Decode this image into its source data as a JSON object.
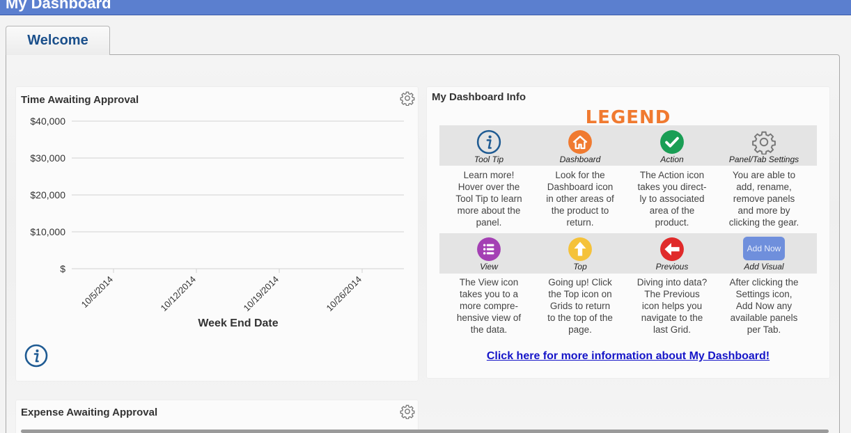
{
  "header": {
    "title": "My Dashboard"
  },
  "tabs": [
    {
      "label": "Welcome",
      "active": true
    }
  ],
  "time_panel": {
    "title": "Time Awaiting Approval",
    "settings_icon": "gear-icon",
    "info_icon": "info-icon"
  },
  "chart_data": {
    "type": "bar",
    "title": "Time Awaiting Approval",
    "xlabel": "Week End Date",
    "ylabel": "",
    "categories": [
      "10/5/2014",
      "10/12/2014",
      "10/19/2014",
      "10/26/2014"
    ],
    "values": [
      0,
      0,
      0,
      0
    ],
    "y_ticks": [
      "$40,000",
      "$30,000",
      "$20,000",
      "$10,000",
      "$"
    ],
    "y_tick_values": [
      40000,
      30000,
      20000,
      10000,
      0
    ],
    "ylim": [
      0,
      40000
    ],
    "grid": true
  },
  "info_panel": {
    "title": "My Dashboard Info",
    "legend_title": "LEGEND",
    "items": [
      {
        "name": "Tool Tip",
        "icon": "info-icon",
        "desc": [
          "Learn more!",
          "Hover over the",
          "Tool Tip to learn",
          "more about the",
          "panel."
        ]
      },
      {
        "name": "Dashboard",
        "icon": "home-icon",
        "desc": [
          "Look for the",
          "Dashboard icon",
          "in other areas of",
          "the product to",
          "return."
        ]
      },
      {
        "name": "Action",
        "icon": "check-icon",
        "desc": [
          "The Action icon",
          "takes you direct-",
          "ly to associated",
          "area of the",
          "product."
        ]
      },
      {
        "name": "Panel/Tab Settings",
        "icon": "gear-icon",
        "desc": [
          "You are able to",
          "add, rename,",
          "remove panels",
          "and more by",
          "clicking the gear."
        ]
      },
      {
        "name": "View",
        "icon": "list-icon",
        "desc": [
          "The View icon",
          "takes you to a",
          "more compre-",
          "hensive view of",
          "the data."
        ]
      },
      {
        "name": "Top",
        "icon": "arrow-up-icon",
        "desc": [
          "Going up! Click",
          "the Top icon on",
          "Grids to return",
          "to the top of the",
          "page."
        ]
      },
      {
        "name": "Previous",
        "icon": "arrow-left-icon",
        "desc": [
          "Diving into data?",
          "The Previous",
          "icon helps you",
          "navigate to the",
          "last Grid."
        ]
      },
      {
        "name": "Add Visual",
        "icon": "add-now-button",
        "button_label": "Add Now",
        "desc": [
          "After clicking the",
          "Settings icon,",
          "Add Now any",
          "available panels",
          "per Tab."
        ]
      }
    ],
    "link_text": "Click here for more information about My Dashboard!"
  },
  "expense_panel": {
    "title": "Expense Awaiting Approval",
    "settings_icon": "gear-icon"
  },
  "colors": {
    "header_bg": "#5b7fcf",
    "tab_text": "#1a4f8b",
    "legend_title": "#f07a30",
    "info_blue": "#1f5b93",
    "dashboard_orange": "#f07a30",
    "action_green": "#1a9e55",
    "view_purple": "#a440b4",
    "top_yellow": "#f5c23a",
    "previous_red": "#e02a2a",
    "add_now_blue": "#6f8fdc",
    "link": "#1515c8"
  }
}
